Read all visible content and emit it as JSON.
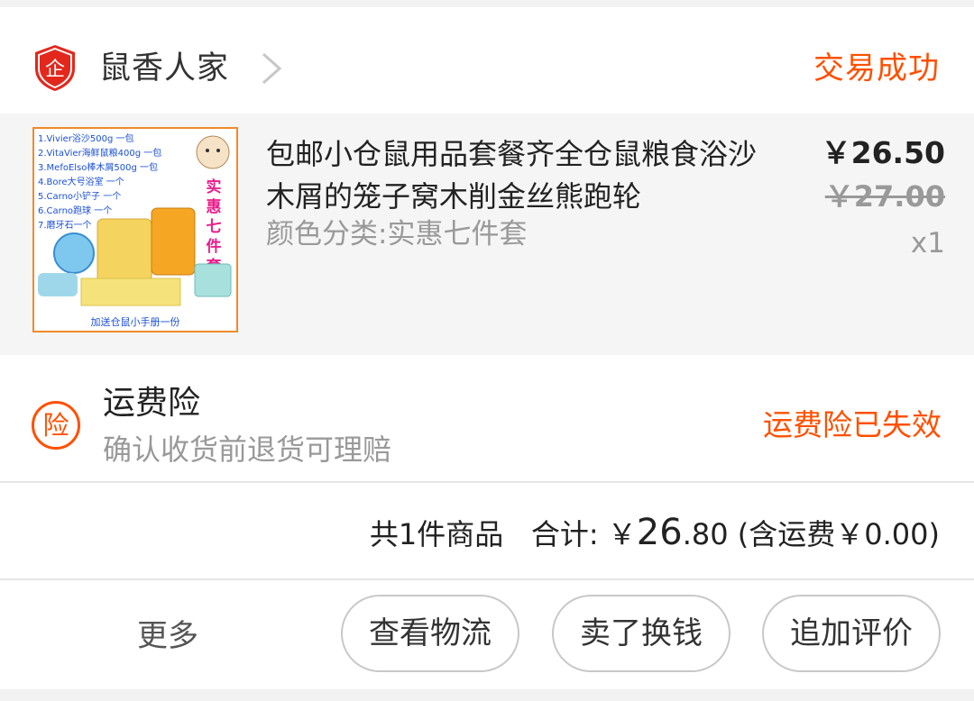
{
  "shop": {
    "icon_glyph": "企",
    "name": "鼠香人家",
    "status": "交易成功"
  },
  "item": {
    "title": "包邮小仓鼠用品套餐齐全仓鼠粮食浴沙木屑的笼子窝木削金丝熊跑轮",
    "sku": "颜色分类:实惠七件套",
    "price": "￥26.50",
    "original_price": "￥27.00",
    "quantity": "x1",
    "thumbnail": {
      "list": [
        "1.Vivier浴沙500g 一包",
        "2.VitaVier海鲜鼠粮400g 一包",
        "3.MefoElso棒木屑500g 一包",
        "4.Bore大号浴室 一个",
        "5.Carno小铲子 一个",
        "6.Carno跑球 一个",
        "7.磨牙石一个"
      ],
      "badge": "实惠七件套",
      "footer": "加送仓鼠小手册一份"
    }
  },
  "insurance": {
    "icon_glyph": "险",
    "title": "运费险",
    "subtitle": "确认收货前退货可理赔",
    "status": "运费险已失效"
  },
  "summary": {
    "count_text": "共1件商品",
    "total_label": "合计:",
    "currency": "￥",
    "total_int": "26",
    "total_dec": ".80",
    "shipping_text": "(含运费￥0.00)"
  },
  "actions": {
    "more": "更多",
    "logistics": "查看物流",
    "resell": "卖了换钱",
    "review": "追加评价"
  },
  "colors": {
    "accent": "#ff5000",
    "shop_icon": "#e3271c"
  }
}
